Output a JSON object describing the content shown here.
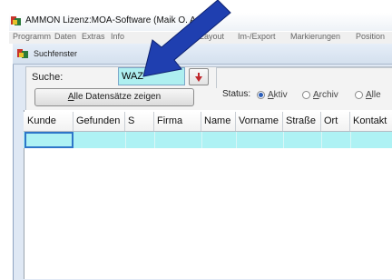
{
  "app": {
    "title": "AMMON   Lizenz:MOA-Software (Maik O. A",
    "menu": [
      "Programm",
      "Daten",
      "Extras",
      "Info",
      "Layout",
      "Im-/Export",
      "Markierungen",
      "Position"
    ]
  },
  "window": {
    "title": "Suchfenster"
  },
  "search": {
    "label": "Suche:",
    "value": "WAZ",
    "dropdown_icon": "red-down-arrow-icon"
  },
  "show_all_button": {
    "accel": "A",
    "label_rest": "lle Datensätze zeigen"
  },
  "status": {
    "label": "Status:",
    "options": [
      {
        "accel": "A",
        "label_rest": "ktiv",
        "selected": true
      },
      {
        "accel": "A",
        "label_rest": "rchiv",
        "selected": false
      },
      {
        "accel": "A",
        "label_rest": "lle",
        "selected": false
      }
    ]
  },
  "grid": {
    "columns": [
      "Kunde",
      "Gefunden",
      "S",
      "Firma",
      "Name",
      "Vorname",
      "Straße",
      "Ort",
      "Kontakt"
    ],
    "rows": [
      [
        "",
        "",
        "",
        "",
        "",
        "",
        "",
        "",
        ""
      ]
    ]
  },
  "colors": {
    "arrow": "#1f3fb0",
    "input_bg": "#aeeff0",
    "row_highlight": "#aef2f4",
    "selection_border": "#2e76c9"
  }
}
